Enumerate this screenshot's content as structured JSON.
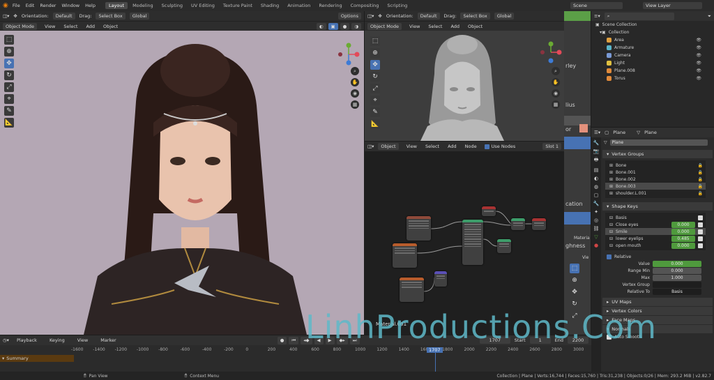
{
  "menu": {
    "items": [
      "File",
      "Edit",
      "Render",
      "Window",
      "Help"
    ],
    "workspaces": [
      "Layout",
      "Modeling",
      "Sculpting",
      "UV Editing",
      "Texture Paint",
      "Shading",
      "Animation",
      "Rendering",
      "Compositing",
      "Scripting"
    ],
    "active_workspace": "Layout",
    "scene": "Scene",
    "view_layer": "View Layer"
  },
  "viewport_left": {
    "orientation_label": "Orientation:",
    "orientation_value": "Default",
    "drag_label": "Drag:",
    "drag_value": "Select Box",
    "transform": "Global",
    "options": "Options",
    "mode": "Object Mode",
    "menus": [
      "View",
      "Select",
      "Add",
      "Object"
    ]
  },
  "viewport_right": {
    "orientation_label": "Orientation:",
    "orientation_value": "Default",
    "drag_label": "Drag:",
    "drag_value": "Select Box",
    "transform": "Global",
    "mode": "Object Mode",
    "menus": [
      "View",
      "Select",
      "Add",
      "Object"
    ]
  },
  "node_editor": {
    "type": "Object",
    "menus": [
      "View",
      "Select",
      "Add",
      "Node"
    ],
    "use_nodes_label": "Use Nodes",
    "slot": "Slot 1",
    "material_name": "Material.001"
  },
  "side_fragments": [
    "rley",
    "lius",
    "or",
    "cation",
    "ghness",
    "Materia",
    "Vie"
  ],
  "outliner": {
    "root": "Scene Collection",
    "collection": "Collection",
    "items": [
      "Area",
      "Armature",
      "Camera",
      "Light",
      "Plane.008",
      "Torus"
    ]
  },
  "properties": {
    "object_name": "Plane",
    "data_name": "Plane",
    "mesh_field": "Plane",
    "vertex_groups_title": "Vertex Groups",
    "vertex_groups": [
      "Bone",
      "Bone.001",
      "Bone.002",
      "Bone.003",
      "shoulder.L.001"
    ],
    "shape_keys_title": "Shape Keys",
    "shape_keys": [
      {
        "name": "Basis",
        "value": ""
      },
      {
        "name": "Close eyes",
        "value": "0.000"
      },
      {
        "name": "Smile",
        "value": "0.000"
      },
      {
        "name": "lower eyelips",
        "value": "0.485"
      },
      {
        "name": "open mouth",
        "value": "0.000"
      }
    ],
    "relative_label": "Relative",
    "value_label": "Value",
    "value": "0.000",
    "range_min_label": "Range Min",
    "range_min": "0.000",
    "max_label": "Max",
    "max": "1.000",
    "vertex_group_label": "Vertex Group",
    "relative_to_label": "Relative To",
    "relative_to": "Basis",
    "uv_maps": "UV Maps",
    "vertex_colors": "Vertex Colors",
    "face_maps": "Face Maps",
    "normals": "Normals",
    "auto_smooth": "Auto Smooth"
  },
  "timeline": {
    "menus": [
      "Playback",
      "Keying",
      "View",
      "Marker"
    ],
    "current_frame": "1707",
    "start_label": "Start",
    "start": "1",
    "end_label": "End",
    "end": "2200",
    "summary": "Summary",
    "ticks": [
      "-1600",
      "-1400",
      "-1200",
      "-1000",
      "-800",
      "-600",
      "-400",
      "-200",
      "0",
      "200",
      "400",
      "600",
      "800",
      "1000",
      "1200",
      "1400",
      "1600",
      "1800",
      "2000",
      "2200",
      "2400",
      "2600",
      "2800",
      "3000"
    ]
  },
  "status": {
    "left": "Pan View",
    "middle": "Context Menu",
    "right": "Collection | Plane | Verts:16,744 | Faces:15,760 | Tris:31,238 | Objects:0/26 | Mem: 293.2 MiB | v2.82.7"
  },
  "watermark": "LinhProductions.Com",
  "colors": {
    "accent_blue": "#4772b3",
    "value_green": "#4f9a3d",
    "watermark": "#5fb9c9"
  }
}
